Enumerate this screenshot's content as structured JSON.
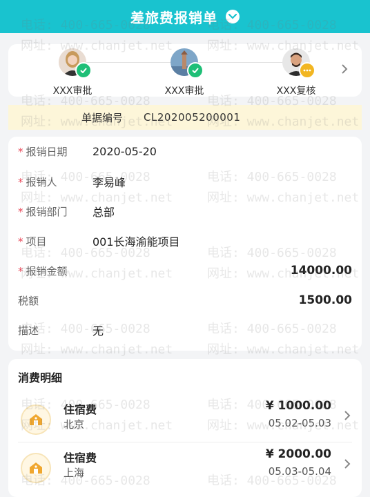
{
  "header": {
    "title": "差旅费报销单"
  },
  "approval_flow": {
    "steps": [
      {
        "label": "XXX审批",
        "status": "approved"
      },
      {
        "label": "XXX审批",
        "status": "approved"
      },
      {
        "label": "XXX复核",
        "status": "pending"
      }
    ]
  },
  "document": {
    "number_label": "单据编号",
    "number_value": "CL202005200001"
  },
  "fields": [
    {
      "label": "报销日期",
      "value": "2020-05-20",
      "required": true
    },
    {
      "label": "报销人",
      "value": "李易峰",
      "required": true
    },
    {
      "label": "报销部门",
      "value": "总部",
      "required": true
    },
    {
      "label": "项目",
      "value": "001长海渝能项目",
      "required": true
    },
    {
      "label": "报销金额",
      "value": "14000.00",
      "required": true
    },
    {
      "label": "税额",
      "value": "1500.00",
      "required": false
    },
    {
      "label": "描述",
      "value": "无",
      "required": false
    }
  ],
  "expense": {
    "title": "消费明细",
    "items": [
      {
        "name": "住宿费",
        "city": "北京",
        "amount": "¥ 1000.00",
        "dates": "05.02-05.03"
      },
      {
        "name": "住宿费",
        "city": "上海",
        "amount": "¥ 2000.00",
        "dates": "05.03-05.04"
      }
    ]
  },
  "watermark": {
    "phone": "电话: 400-665-0028",
    "site": "网址: www.chanjet.net"
  },
  "colors": {
    "header": "#19c3cf",
    "approved": "#1fbf77",
    "pending": "#f2b622",
    "required": "#e9495a",
    "docno_bg": "#fdf6d9"
  }
}
